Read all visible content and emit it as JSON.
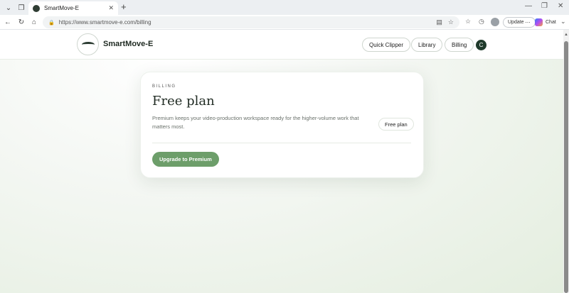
{
  "browser": {
    "tab_title": "SmartMove-E",
    "url": "https://www.smartmove-e.com/billing",
    "update_label": "Update",
    "chat_label": "Chat"
  },
  "header": {
    "brand_name": "SmartMove-E",
    "nav": [
      {
        "label": "Quick Clipper"
      },
      {
        "label": "Library"
      },
      {
        "label": "Billing"
      }
    ],
    "avatar_initial": "C"
  },
  "billing": {
    "eyebrow": "BILLING",
    "title": "Free plan",
    "description": "Premium keeps your video-production workspace ready for the higher-volume work that matters most.",
    "plan_badge": "Free plan",
    "upgrade_label": "Upgrade to Premium"
  },
  "colors": {
    "accent": "#6d9e6a",
    "avatar_bg": "#1f3a2b"
  }
}
